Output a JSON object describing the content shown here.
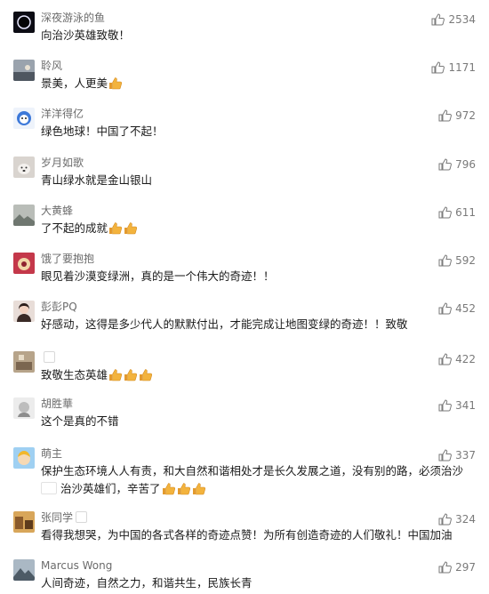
{
  "comments": [
    {
      "name": "深夜游泳的鱼",
      "text": "向治沙英雄致敬！",
      "likes": "2534",
      "thumbs": 0,
      "avatar": "dark-ring-avatar"
    },
    {
      "name": "聆风",
      "text": "景美，人更美",
      "likes": "1171",
      "thumbs": 1,
      "avatar": "dusk-avatar"
    },
    {
      "name": "洋洋得亿",
      "text": "绿色地球！中国了不起！",
      "likes": "972",
      "thumbs": 0,
      "avatar": "cartoon-avatar"
    },
    {
      "name": "岁月如歌",
      "text": "青山绿水就是金山银山",
      "likes": "796",
      "thumbs": 0,
      "avatar": "dog-avatar"
    },
    {
      "name": "大黄蜂",
      "text": "了不起的成就",
      "likes": "611",
      "thumbs": 2,
      "avatar": "landscape-avatar"
    },
    {
      "name": "饿了要抱抱",
      "text": "眼见着沙漠变绿洲，真的是一个伟大的奇迹！！",
      "likes": "592",
      "thumbs": 0,
      "avatar": "food-avatar"
    },
    {
      "name": "彭彭PQ",
      "text": "好感动，这得是多少代人的默默付出，才能完成让地图变绿的奇迹！！致敬",
      "likes": "452",
      "thumbs": 0,
      "avatar": "portrait-avatar"
    },
    {
      "name": "",
      "text": "致敬生态英雄",
      "likes": "422",
      "thumbs": 3,
      "avatar": "room-avatar"
    },
    {
      "name": "胡胜華",
      "text": "这个是真的不错",
      "likes": "341",
      "thumbs": 0,
      "avatar": "sketch-avatar"
    },
    {
      "name": "萌主",
      "text": "保护生态环境人人有责，和大自然和谐相处才是长久发展之道，没有别的路，必须治沙",
      "text2": "治沙英雄们，辛苦了",
      "likes": "337",
      "thumbs": 0,
      "thumbs2": 3,
      "avatar": "kid-avatar"
    },
    {
      "name": "张同学",
      "text": "看得我想哭，为中国的各式各样的奇迹点赞！为所有创造奇迹的人们敬礼！中国加油",
      "likes": "324",
      "thumbs": 0,
      "avatar": "street-avatar"
    },
    {
      "name": "Marcus Wong",
      "text": "人间奇迹，自然之力，和谐共生，民族长青",
      "likes": "297",
      "thumbs": 0,
      "avatar": "mountain-avatar"
    }
  ],
  "icons": {
    "like": "thumbs-up-outline-icon",
    "emoji": "thumbs-up-emoji"
  },
  "colors": {
    "name": "#6b6b6b",
    "text": "#1a1a1a",
    "like": "#7a7a7a",
    "emoji": "#f3b33d"
  }
}
